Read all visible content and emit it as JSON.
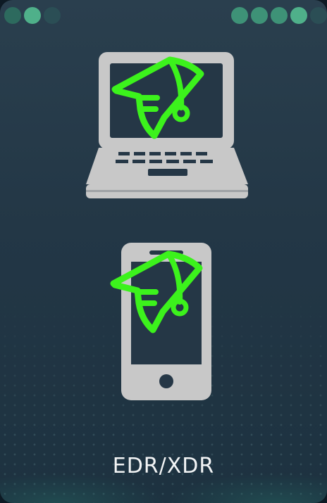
{
  "card": {
    "label": "EDR/XDR"
  },
  "icons": {
    "device_top": "laptop-icon",
    "device_bottom": "smartphone-icon",
    "overlay": "winged-shield-icon"
  },
  "colors": {
    "background": "#233746",
    "device": "#c8c8c8",
    "accent": "#3cf21c",
    "dot_bright": "#4fb08a",
    "dot_dim": "#2d6a5e",
    "text": "#f2f4f5"
  }
}
